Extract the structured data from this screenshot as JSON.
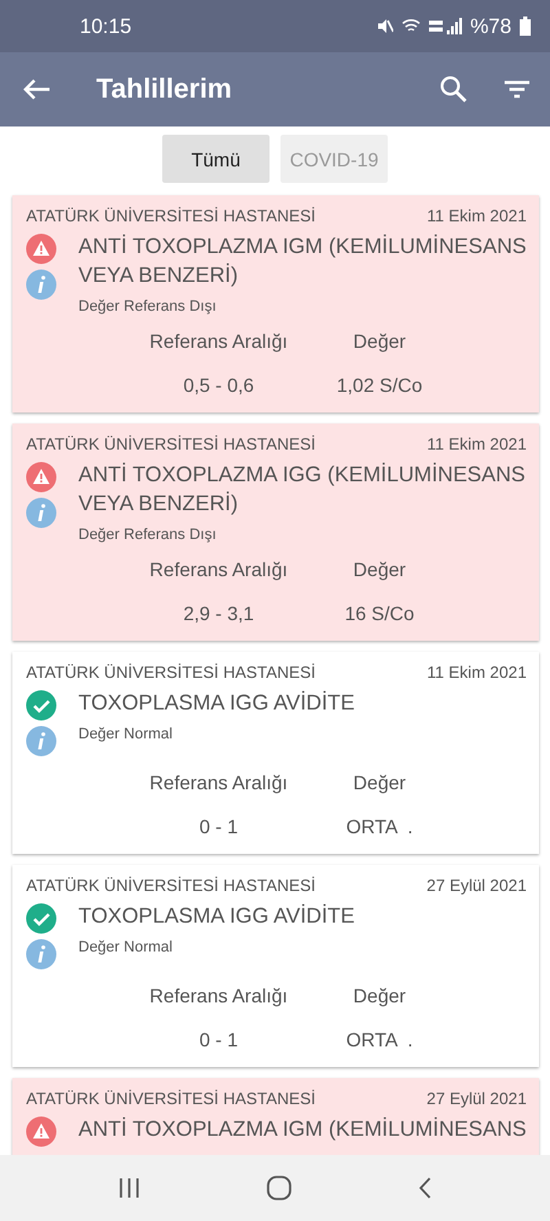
{
  "status_bar": {
    "time": "10:15",
    "battery": "%78"
  },
  "app_bar": {
    "title": "Tahlillerim"
  },
  "filters": [
    {
      "label": "Tümü",
      "selected": true
    },
    {
      "label": "COVID-19",
      "selected": false
    }
  ],
  "results": [
    {
      "kind": "abnormal",
      "hospital": "ATATÜRK ÜNİVERSİTESİ HASTANESİ",
      "date": "11 Ekim 2021",
      "test": "ANTİ TOXOPLAZMA IGM (KEMİLUMİNESANS VEYA BENZERİ)",
      "status": "Değer Referans Dışı",
      "range_label": "Referans Aralığı",
      "value_label": "Değer",
      "range": "0,5 - 0,6",
      "value": "1,02 S/Co"
    },
    {
      "kind": "abnormal",
      "hospital": "ATATÜRK ÜNİVERSİTESİ HASTANESİ",
      "date": "11 Ekim 2021",
      "test": "ANTİ TOXOPLAZMA IGG (KEMİLUMİNESANS VEYA BENZERİ)",
      "status": "Değer Referans Dışı",
      "range_label": "Referans Aralığı",
      "value_label": "Değer",
      "range": "2,9 - 3,1",
      "value": "16 S/Co"
    },
    {
      "kind": "normal",
      "hospital": "ATATÜRK ÜNİVERSİTESİ HASTANESİ",
      "date": "11 Ekim 2021",
      "test": "TOXOPLASMA IGG AVİDİTE",
      "status": "Değer Normal",
      "range_label": "Referans Aralığı",
      "value_label": "Değer",
      "range": "0 - 1",
      "value": "ORTA  ."
    },
    {
      "kind": "normal",
      "hospital": "ATATÜRK ÜNİVERSİTESİ HASTANESİ",
      "date": "27 Eylül 2021",
      "test": "TOXOPLASMA IGG AVİDİTE",
      "status": "Değer Normal",
      "range_label": "Referans Aralığı",
      "value_label": "Değer",
      "range": "0 - 1",
      "value": "ORTA  ."
    },
    {
      "kind": "abnormal",
      "hospital": "ATATÜRK ÜNİVERSİTESİ HASTANESİ",
      "date": "27 Eylül 2021",
      "test": "ANTİ TOXOPLAZMA IGM (KEMİLUMİNESANS"
    }
  ]
}
